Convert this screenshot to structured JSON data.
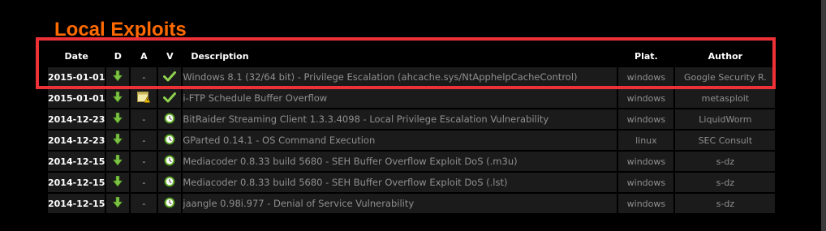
{
  "page": {
    "title": "Local Exploits"
  },
  "table": {
    "headers": {
      "date": "Date",
      "download": "D",
      "app": "A",
      "verified": "V",
      "description": "Description",
      "platform": "Plat.",
      "author": "Author"
    },
    "rows": [
      {
        "date": "2015-01-01",
        "app": "-",
        "verified_icon": "check-icon",
        "description": "Windows 8.1 (32/64 bit) - Privilege Escalation (ahcache.sys/NtApphelpCacheControl)",
        "platform": "windows",
        "author": "Google Security R."
      },
      {
        "date": "2015-01-01",
        "app": "app-icon",
        "verified_icon": "check-icon",
        "description": "i-FTP Schedule Buffer Overflow",
        "platform": "windows",
        "author": "metasploit"
      },
      {
        "date": "2014-12-23",
        "app": "-",
        "verified_icon": "clock-icon",
        "description": "BitRaider Streaming Client 1.3.3.4098 - Local Privilege Escalation Vulnerability",
        "platform": "windows",
        "author": "LiquidWorm"
      },
      {
        "date": "2014-12-23",
        "app": "-",
        "verified_icon": "clock-icon",
        "description": "GParted 0.14.1 - OS Command Execution",
        "platform": "linux",
        "author": "SEC Consult"
      },
      {
        "date": "2014-12-15",
        "app": "-",
        "verified_icon": "clock-icon",
        "description": "Mediacoder 0.8.33 build 5680 - SEH Buffer Overflow Exploit DoS (.m3u)",
        "platform": "windows",
        "author": "s-dz"
      },
      {
        "date": "2014-12-15",
        "app": "-",
        "verified_icon": "clock-icon",
        "description": "Mediacoder 0.8.33 build 5680 - SEH Buffer Overflow Exploit DoS (.lst)",
        "platform": "windows",
        "author": "s-dz"
      },
      {
        "date": "2014-12-15",
        "app": "-",
        "verified_icon": "clock-icon",
        "description": "jaangle 0.98i.977 - Denial of Service Vulnerability",
        "platform": "windows",
        "author": "s-dz"
      }
    ]
  },
  "colors": {
    "title": "#ff6a00",
    "highlight_box": "#ee3137",
    "download_arrow": "#7cc243",
    "row_background": "#1b1b1b"
  },
  "icons": {
    "download": "download-arrow-icon",
    "verified": "check-icon",
    "pending": "clock-icon",
    "app": "app-icon"
  }
}
